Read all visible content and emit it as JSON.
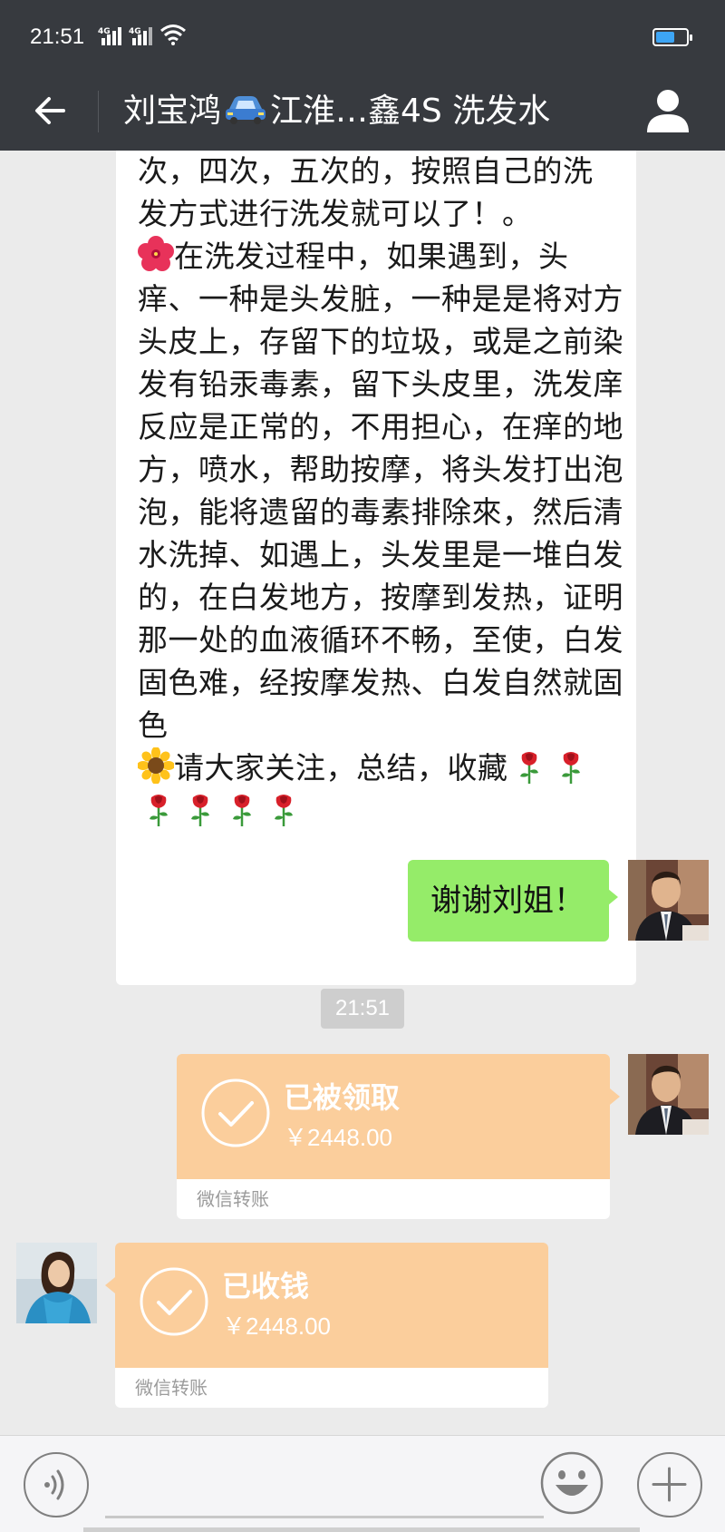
{
  "status_bar": {
    "time": "21:51",
    "network_1": "4G",
    "network_2": "4G",
    "battery_color": "#3da5f5"
  },
  "nav": {
    "back_icon": "arrow-left-icon",
    "title_before": "刘宝鸿",
    "title_emoji": "car-icon",
    "title_after": "江淮…鑫4S   洗发水",
    "profile_icon": "person-icon"
  },
  "messages": {
    "long_text": {
      "line_partial": "次，四次，五次的，按照自己的洗",
      "p1": "发方式进行洗发就可以了！。",
      "p2_emoji": "hibiscus-icon",
      "p2": "在洗发过程中，如果遇到，头痒、一种是头发脏，一种是是将对方头皮上，存留下的垃圾，或是之前染发有铅汞毒素，留下头皮里，洗发庠反应是正常的，不用担心，在痒的地方，喷水，帮助按摩，将头发打出泡泡，能将遗留的毒素排除來，然后清水洗掉、如遇上，头发里是一堆白发的，在白发地方，按摩到发热，证明那一处的血液循环不畅，至使，白发固色难，经按摩发热、白发自然就固色",
      "p3_emoji": "sunflower-icon",
      "p3": "请大家关注，总结，收藏",
      "roses_count": 6
    },
    "reply": "谢谢刘姐！",
    "timestamp": "21:51",
    "transfer_sent": {
      "title": "已被领取",
      "amount": "￥2448.00",
      "label": "微信转账"
    },
    "transfer_received": {
      "title": "已收钱",
      "amount": "￥2448.00",
      "label": "微信转账"
    }
  },
  "input_bar": {
    "voice_icon": "voice-icon",
    "emoji_icon": "smiley-icon",
    "plus_icon": "plus-icon"
  },
  "colors": {
    "header": "#373a3f",
    "chat_bg": "#ebebeb",
    "sent_bubble": "#95ec69",
    "transfer_bubble": "#fbce9c"
  }
}
